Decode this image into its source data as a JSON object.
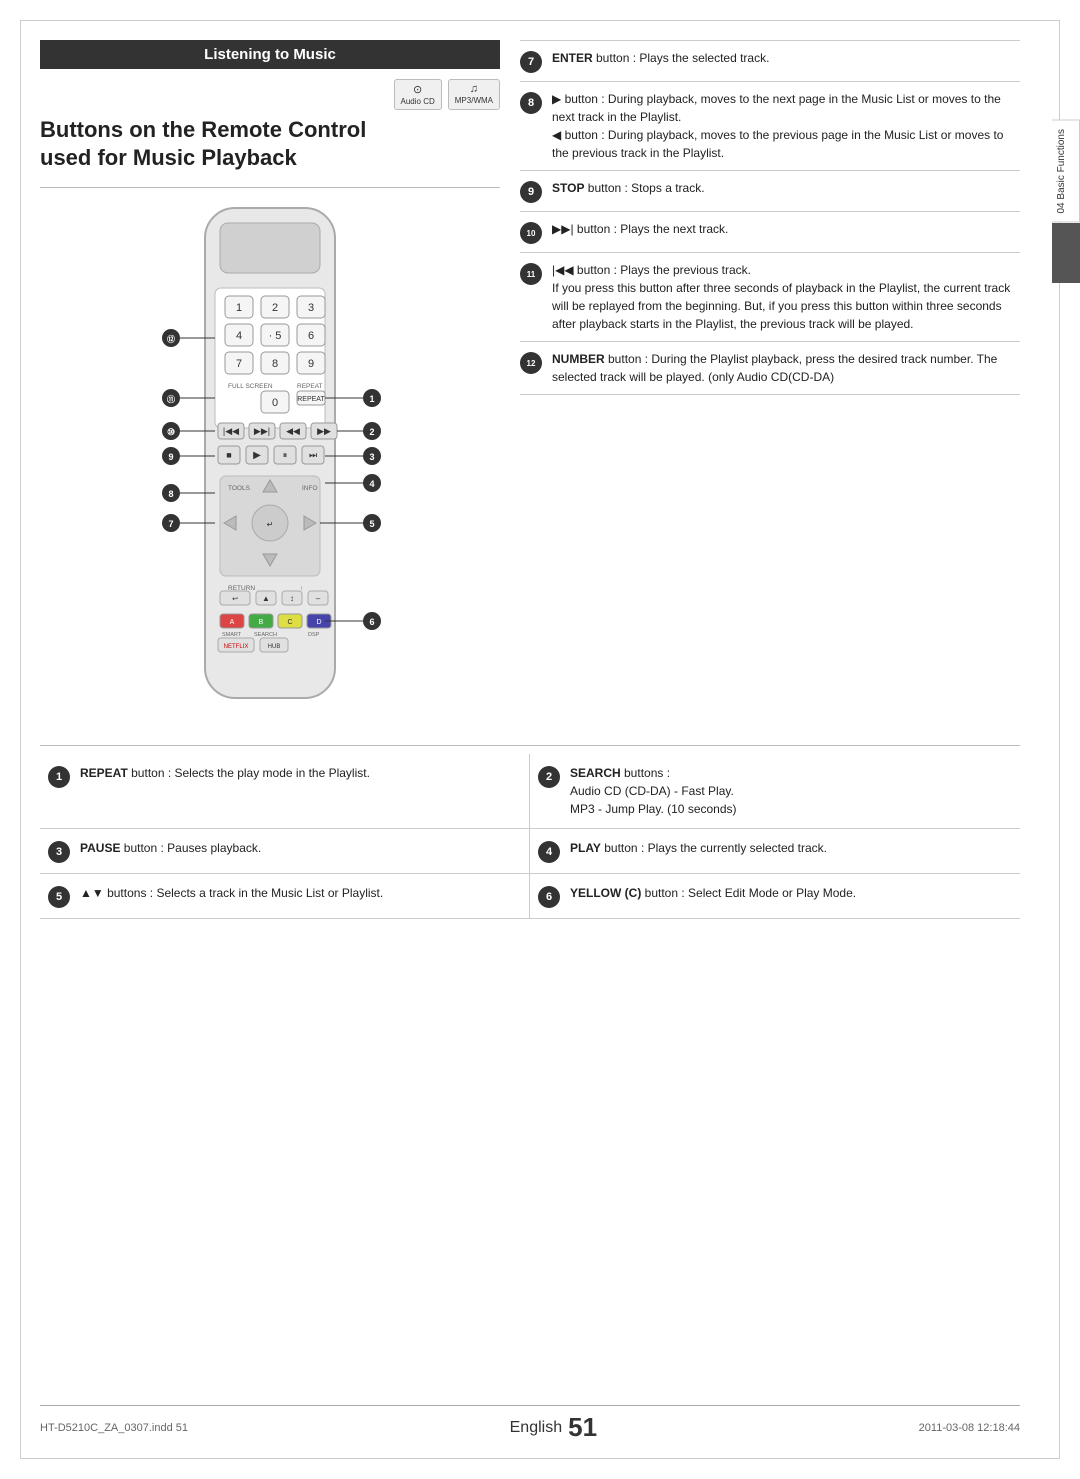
{
  "page": {
    "title": "Listening to Music",
    "subtitle": "Buttons on the Remote Control\nused for Music Playback",
    "language": "English",
    "page_number": "51",
    "footer_left": "HT-D5210C_ZA_0307.indd  51",
    "footer_right": "2011-03-08     12:18:44",
    "side_tab_text": "04  Basic Functions"
  },
  "media_icons": [
    {
      "symbol": "⊙",
      "label": "Audio CD"
    },
    {
      "symbol": "♫",
      "label": "MP3/WMA"
    }
  ],
  "right_items": [
    {
      "num": "7",
      "text_bold": "ENTER",
      "text": " button : Plays the selected track."
    },
    {
      "num": "8",
      "text": "▶ button : During playback, moves to the next page in the Music List or moves to the next track in the Playlist.\n◀ button : During playback, moves to the previous page in the Music List or moves to the previous track in the Playlist."
    },
    {
      "num": "9",
      "text_bold": "STOP",
      "text": " button : Stops a track."
    },
    {
      "num": "10",
      "text": "▶▶| button : Plays the next track."
    },
    {
      "num": "11",
      "text": "|◀◀ button : Plays the previous track.\nIf you press this button after three seconds of playback in the Playlist, the current track will be replayed from the beginning. But, if you press this button within three seconds after playback starts in the Playlist, the previous track will be played."
    },
    {
      "num": "12",
      "text_bold": "NUMBER",
      "text": " button : During the Playlist playback, press the desired track number. The selected track will be played. (only Audio CD(CD-DA)"
    }
  ],
  "bottom_items": [
    {
      "num": "1",
      "text_bold": "REPEAT",
      "text": " button : Selects the play mode in the Playlist."
    },
    {
      "num": "2",
      "text_bold": "SEARCH",
      "text": " buttons :\nAudio CD (CD-DA) - Fast Play.\nMP3 - Jump Play. (10 seconds)"
    },
    {
      "num": "3",
      "text_bold": "PAUSE",
      "text": " button : Pauses playback."
    },
    {
      "num": "4",
      "text_bold": "PLAY",
      "text": " button : Plays the currently selected track."
    },
    {
      "num": "5",
      "text": "▲▼ buttons : Selects a track in the Music List or Playlist."
    },
    {
      "num": "6",
      "text_bold": "YELLOW (C)",
      "text": " button : Select Edit Mode or Play Mode."
    }
  ]
}
